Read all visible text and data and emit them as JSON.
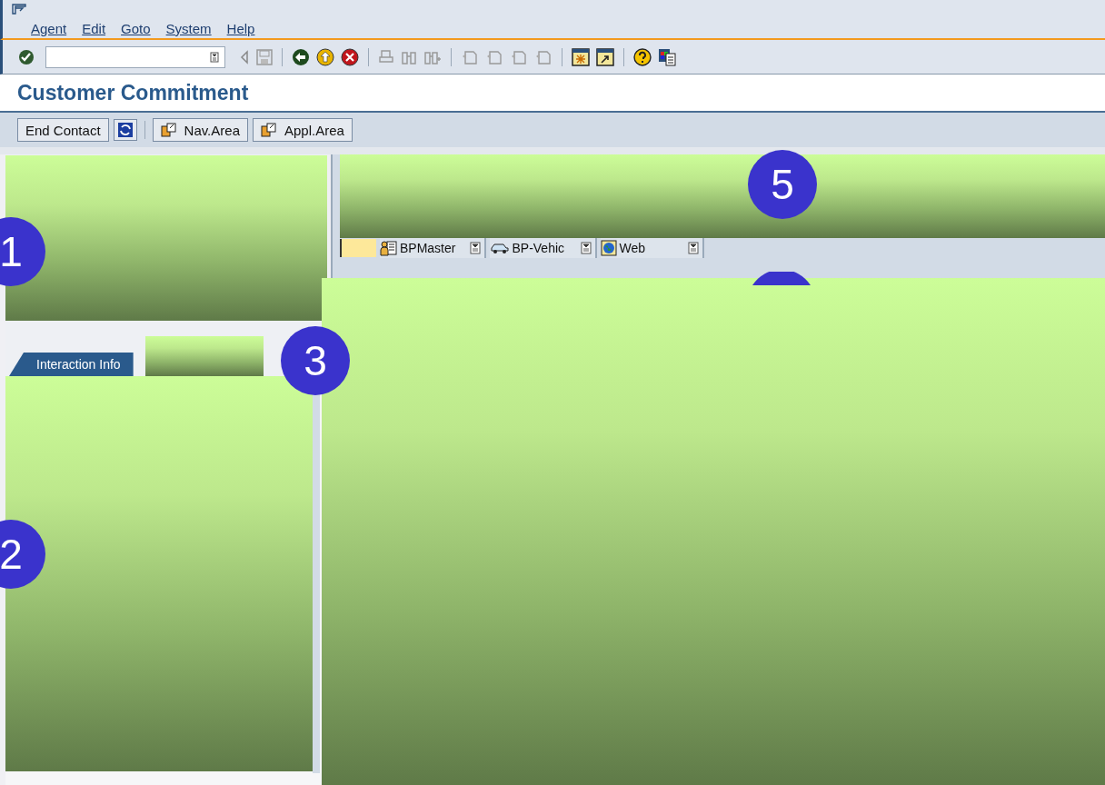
{
  "menu": [
    {
      "label": "Agent"
    },
    {
      "label": "Edit"
    },
    {
      "label": "Goto"
    },
    {
      "label": "System"
    },
    {
      "label": "Help"
    }
  ],
  "title": "Customer Commitment",
  "app_toolbar": [
    {
      "label": "End Contact",
      "kind": "text"
    },
    {
      "label": "Nav.Area",
      "kind": "icon-text"
    },
    {
      "label": "Appl.Area",
      "kind": "icon-text"
    }
  ],
  "left_tabs": [
    {
      "label": "Interaction Info",
      "selected": true
    }
  ],
  "right_tabs": [
    {
      "label": "BPMaster",
      "kind": "person",
      "selected": false
    },
    {
      "label": "BP-Vehic",
      "kind": "car",
      "selected": false
    },
    {
      "label": "Web",
      "kind": "globe",
      "selected": false
    }
  ],
  "callouts": [
    "1",
    "2",
    "3",
    "5"
  ]
}
